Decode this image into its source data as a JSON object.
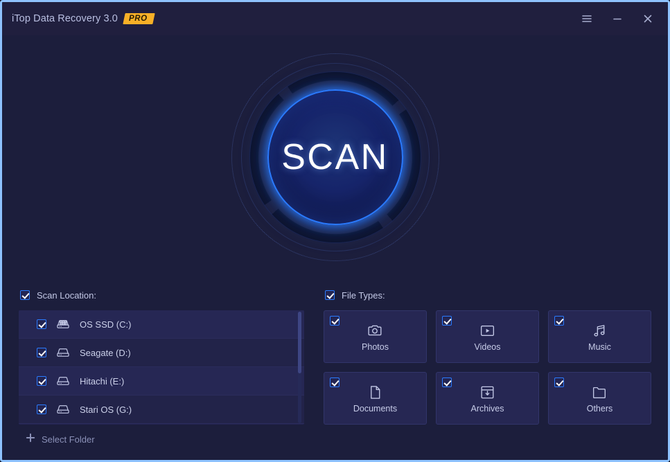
{
  "window": {
    "title": "iTop Data Recovery 3.0",
    "badge": "PRO",
    "controls": {
      "menu": "menu-icon",
      "minimize": "minimize-icon",
      "close": "close-icon"
    },
    "border_color": "#8ec2fd",
    "background_color": "#1c1e3c",
    "titlebar_color": "#201f3e",
    "badge_color": "#f7b027"
  },
  "scan": {
    "label": "SCAN",
    "accent_color": "#2a7bff"
  },
  "scan_location": {
    "header_label": "Scan Location:",
    "header_checked": true,
    "drives": [
      {
        "label": "OS SSD (C:)",
        "checked": true,
        "icon": "ssd-icon"
      },
      {
        "label": "Seagate (D:)",
        "checked": true,
        "icon": "hdd-icon"
      },
      {
        "label": "Hitachi (E:)",
        "checked": true,
        "icon": "hdd-icon"
      },
      {
        "label": "Stari OS (G:)",
        "checked": true,
        "icon": "hdd-icon"
      }
    ],
    "select_folder_label": "Select Folder",
    "select_folder_icon": "plus-icon",
    "scrollbar": {
      "thumb_percent": 55
    }
  },
  "file_types": {
    "header_label": "File Types:",
    "header_checked": true,
    "items": [
      {
        "label": "Photos",
        "checked": true,
        "icon": "camera-icon"
      },
      {
        "label": "Videos",
        "checked": true,
        "icon": "video-play-icon"
      },
      {
        "label": "Music",
        "checked": true,
        "icon": "music-note-icon"
      },
      {
        "label": "Documents",
        "checked": true,
        "icon": "document-icon"
      },
      {
        "label": "Archives",
        "checked": true,
        "icon": "archive-box-icon"
      },
      {
        "label": "Others",
        "checked": true,
        "icon": "folder-icon"
      }
    ]
  }
}
